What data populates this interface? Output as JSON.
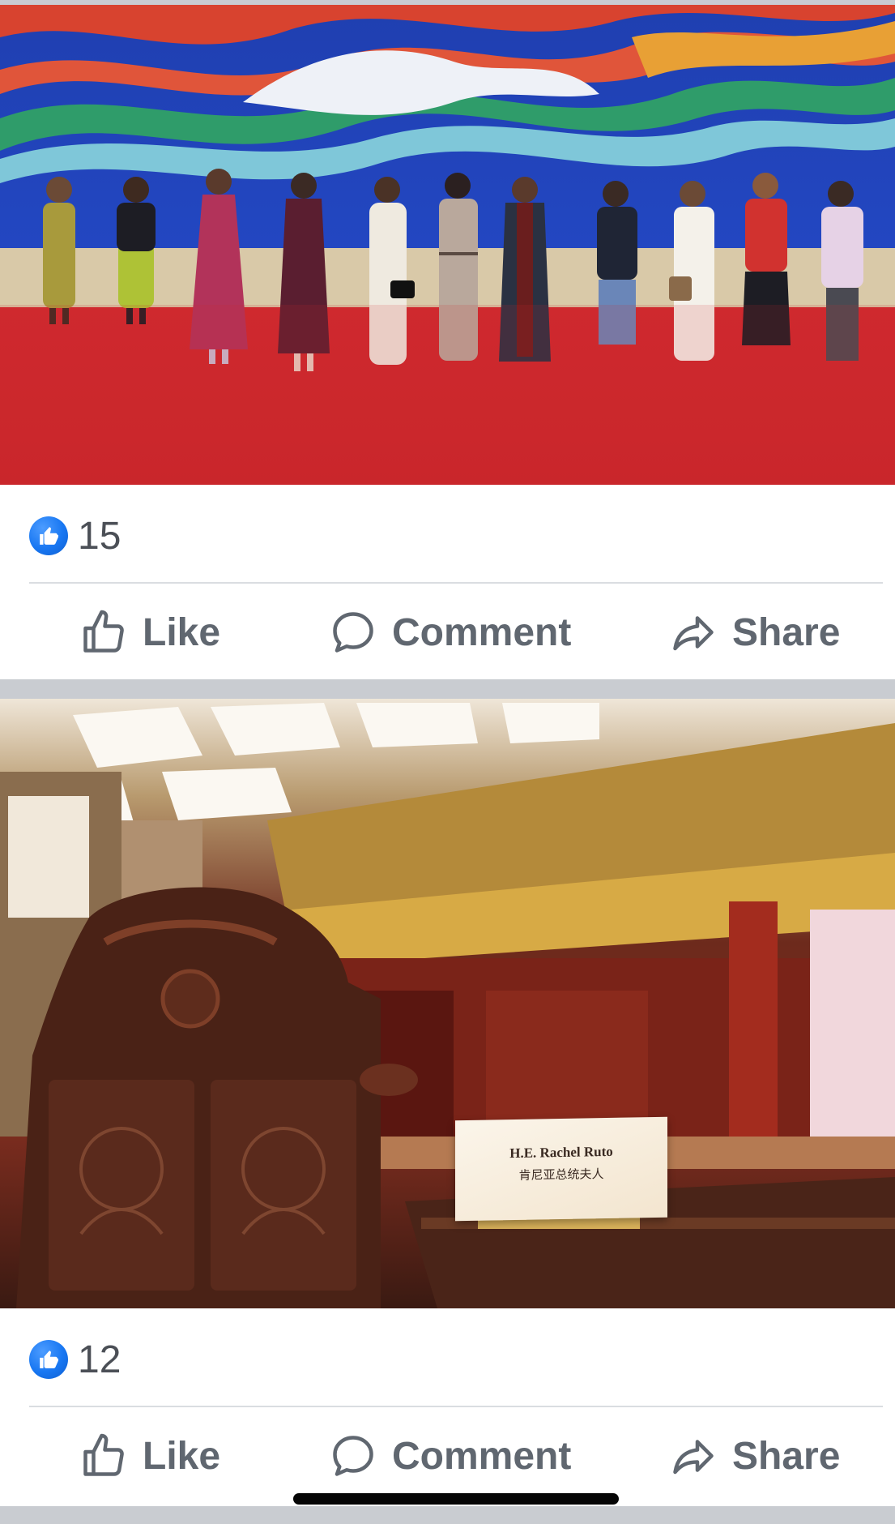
{
  "posts": [
    {
      "photo": {
        "subject": "group-photo"
      },
      "reactions": {
        "icon": "like-reaction-icon",
        "count": "15"
      },
      "actions": {
        "like_label": "Like",
        "comment_label": "Comment",
        "share_label": "Share"
      }
    },
    {
      "photo": {
        "subject": "carved-chair-and-nameplate",
        "nameplate_name": "H.E. Rachel Ruto",
        "nameplate_subtitle": "肯尼亚总统夫人"
      },
      "reactions": {
        "icon": "like-reaction-icon",
        "count": "12"
      },
      "actions": {
        "like_label": "Like",
        "comment_label": "Comment",
        "share_label": "Share"
      }
    }
  ],
  "colors": {
    "brand_blue": "#1877f2",
    "action_text": "#606770",
    "count_text": "#4b4f56",
    "separator": "#c9ccd1",
    "divider": "#dadde1"
  }
}
